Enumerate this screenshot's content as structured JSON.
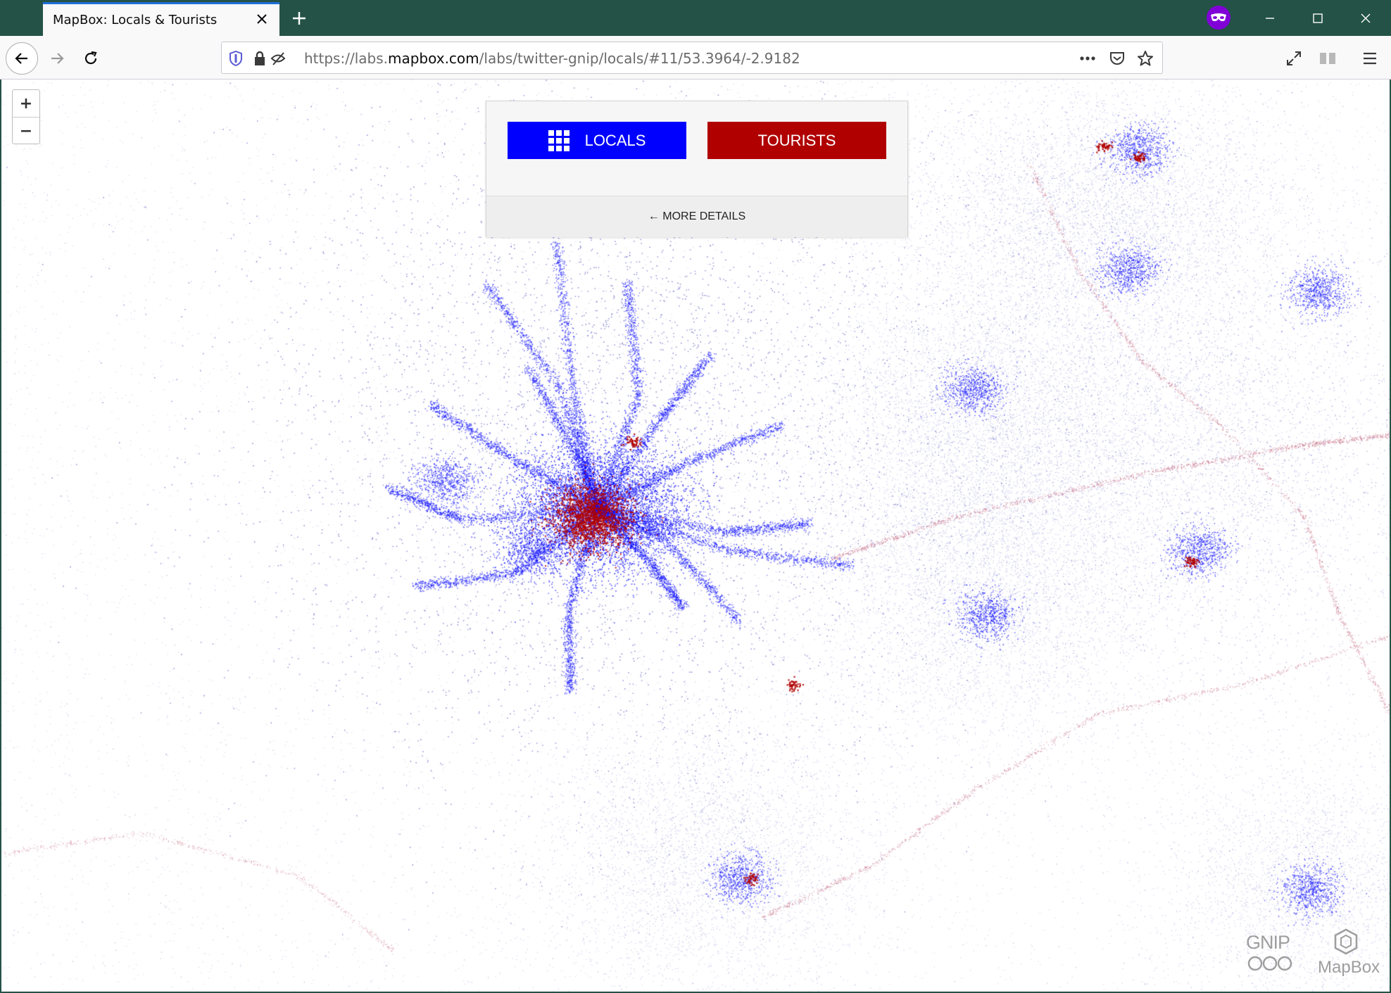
{
  "browser": {
    "tab_title": "MapBox: Locals & Tourists",
    "url_prefix": "https://labs.",
    "url_domain": "mapbox.com",
    "url_path": "/labs/twitter-gnip/locals/#11/53.3964/-2.9182"
  },
  "map": {
    "zoom_in_label": "+",
    "zoom_out_label": "−",
    "colors": {
      "locals": "#0000ff",
      "tourists": "#b00000"
    }
  },
  "panel": {
    "locals_label": "LOCALS",
    "tourists_label": "TOURISTS",
    "more_details_label": "← MORE DETAILS"
  },
  "logos": {
    "gnip": "GNIP",
    "mapbox": "MapBox"
  },
  "icons": [
    "close-icon",
    "plus-icon",
    "private-browsing-icon",
    "minimize-icon",
    "maximize-icon",
    "window-close-icon",
    "back-arrow-icon",
    "forward-arrow-icon",
    "reload-icon",
    "shield-icon",
    "lock-icon",
    "tracking-icon",
    "more-icon",
    "pocket-icon",
    "bookmark-star-icon",
    "fullscreen-icon",
    "reader-icon",
    "hamburger-menu-icon",
    "grid-icon"
  ]
}
